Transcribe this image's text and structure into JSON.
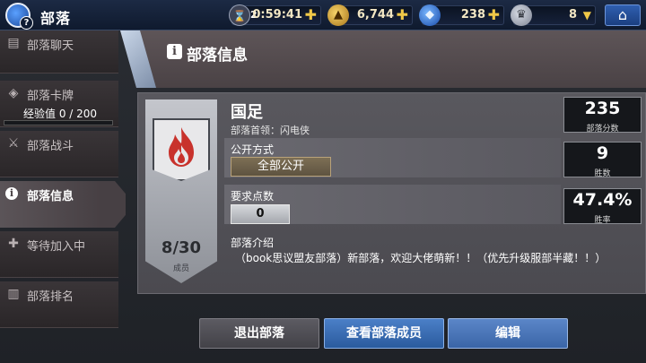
{
  "topbar": {
    "title": "部落",
    "avatar_badge": "?",
    "time": {
      "count": "2",
      "value": "0:59:41",
      "plus": "✚",
      "icon": "hourglass-icon"
    },
    "gold": {
      "value": "6,744",
      "plus": "✚",
      "icon": "gold-coin-icon"
    },
    "gem": {
      "value": "238",
      "plus": "✚",
      "icon": "gem-icon"
    },
    "trophy": {
      "value": "8",
      "arrow": "▼",
      "icon": "trophy-icon"
    },
    "home_icon": "⌂"
  },
  "sidebar": {
    "items": [
      {
        "label": "部落聊天",
        "icon": "chat-icon",
        "glyph": "▤"
      },
      {
        "label": "部落卡牌",
        "icon": "cards-icon",
        "glyph": "◈"
      },
      {
        "label": "部落战斗",
        "icon": "crossed-swords-icon",
        "glyph": "⚔"
      },
      {
        "label": "部落信息",
        "icon": "info-icon",
        "glyph": "i"
      },
      {
        "label": "等待加入中",
        "icon": "plus-icon",
        "glyph": "✚"
      },
      {
        "label": "部落排名",
        "icon": "ranking-icon",
        "glyph": "▥"
      }
    ],
    "exp_label": "经验值",
    "exp_value": "0 / 200",
    "exp_fraction": 0
  },
  "header": {
    "title": "部落信息",
    "info_glyph": "i"
  },
  "tribe": {
    "name": "国足",
    "leader_label": "部落首领：",
    "leader_name": "闪电侠",
    "publicity_label": "公开方式",
    "publicity_value": "全部公开",
    "required_points_label": "要求点数",
    "required_points_value": "0",
    "intro_label": "部落介绍",
    "intro_text": "（book思议盟友部落）新部落，欢迎大佬萌新！！（优先升级服部半藏！！）",
    "member_count": "8/30",
    "member_label": "成员"
  },
  "stats": [
    {
      "value": "235",
      "label": "部落分数"
    },
    {
      "value": "9",
      "label": "胜数"
    },
    {
      "value": "47.4%",
      "label": "胜率"
    }
  ],
  "buttons": {
    "leave": "退出部落",
    "view_members": "查看部落成员",
    "edit": "编辑"
  },
  "colors": {
    "accent_blue": "#2a5b9e",
    "flame_red": "#c8322c",
    "gold_text": "#f3e7c4"
  }
}
